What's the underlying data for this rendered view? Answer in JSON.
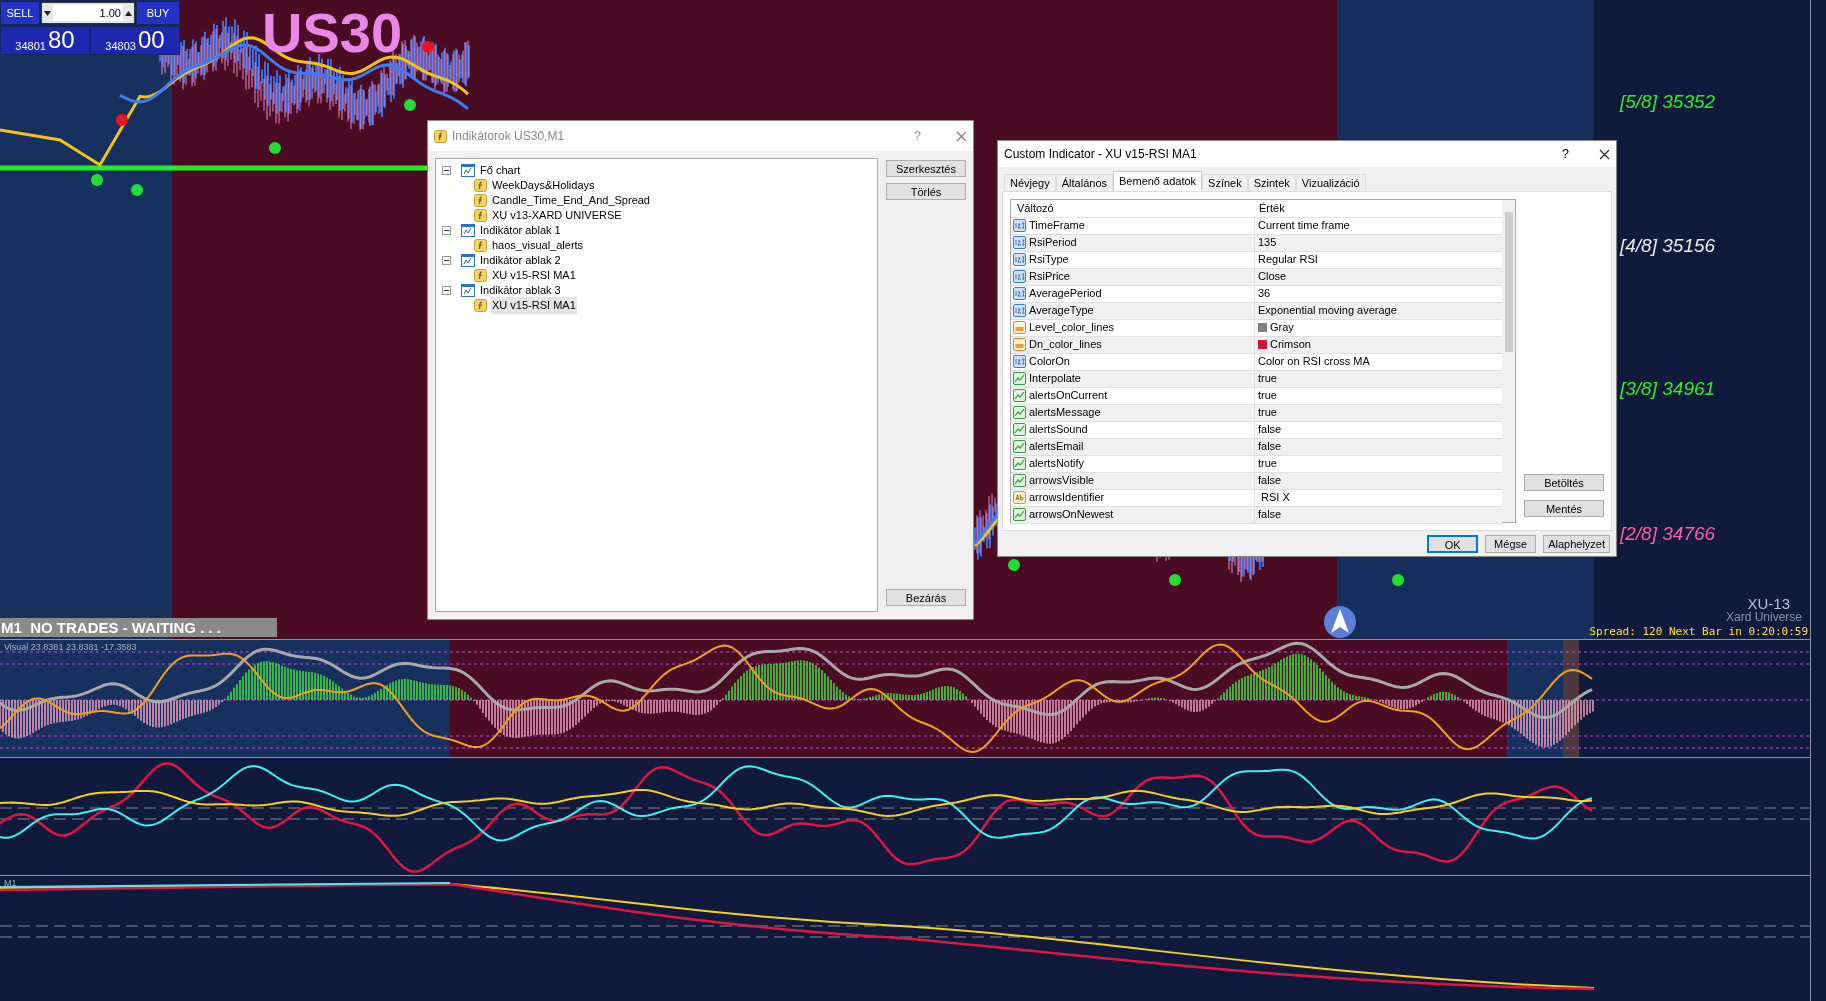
{
  "trade_panel": {
    "sell": "SELL",
    "lot": "1.00",
    "buy": "BUY",
    "bid_small": "34801",
    "bid_big": "80",
    "ask_small": "34803",
    "ask_big": "00"
  },
  "chart": {
    "symbol": "US30",
    "status": "M1  NO TRADES - WAITING . . .",
    "brand": "XU-13",
    "brand_sub": "Xard Universe",
    "spread": "Spread: 120 Next Bar in 0:20:0:59",
    "levels": [
      {
        "label": "[5/8] 35352",
        "color": "#33ee22"
      },
      {
        "label": "[4/8] 35156",
        "color": "#eeeeee"
      },
      {
        "label": "[3/8] 34961",
        "color": "#33ee22"
      },
      {
        "label": "[2/8] 34766",
        "color": "#ff5fa8"
      }
    ]
  },
  "indicator_labels": {
    "oscillator": "Visual 23.8381 23.8381 -17.3583",
    "trend": "M1"
  },
  "indicators_dialog": {
    "title": "Indikátorok US30,M1",
    "help": "?",
    "tree": [
      {
        "label": "Fő chart",
        "expanded": true,
        "children": [
          {
            "label": "WeekDays&Holidays",
            "selected": false
          },
          {
            "label": "Candle_Time_End_And_Spread",
            "selected": false
          },
          {
            "label": "XU v13-XARD UNIVERSE",
            "selected": false
          }
        ]
      },
      {
        "label": "Indikátor ablak 1",
        "expanded": true,
        "children": [
          {
            "label": "haos_visual_alerts",
            "selected": false
          }
        ]
      },
      {
        "label": "Indikátor ablak 2",
        "expanded": true,
        "children": [
          {
            "label": "XU v15-RSI MA1",
            "selected": false
          }
        ]
      },
      {
        "label": "Indikátor ablak 3",
        "expanded": true,
        "children": [
          {
            "label": "XU v15-RSI MA1",
            "selected": true
          }
        ]
      }
    ],
    "buttons": [
      "Szerkesztés",
      "Törlés"
    ],
    "close_button": "Bezárás"
  },
  "custom_dialog": {
    "title": "Custom Indicator - XU v15-RSI MA1",
    "help": "?",
    "tabs": [
      {
        "label": "Névjegy",
        "selected": false
      },
      {
        "label": "Általános",
        "selected": false
      },
      {
        "label": "Bemenő adatok",
        "selected": true
      },
      {
        "label": "Színek",
        "selected": false
      },
      {
        "label": "Szintek",
        "selected": false
      },
      {
        "label": "Vizualizáció",
        "selected": false
      }
    ],
    "columns": [
      "Változó",
      "Érték"
    ],
    "rows": [
      {
        "kind": "number",
        "name": "TimeFrame",
        "value": "Current time frame"
      },
      {
        "kind": "number",
        "name": "RsiPeriod",
        "value": "135"
      },
      {
        "kind": "number",
        "name": "RsiType",
        "value": "Regular RSI"
      },
      {
        "kind": "number",
        "name": "RsiPrice",
        "value": "Close"
      },
      {
        "kind": "number",
        "name": "AveragePeriod",
        "value": "36"
      },
      {
        "kind": "number",
        "name": "AverageType",
        "value": "Exponential moving average"
      },
      {
        "kind": "color",
        "name": "Level_color_lines",
        "value": "Gray",
        "color": "#808080"
      },
      {
        "kind": "color",
        "name": "Dn_color_lines",
        "value": "Crimson",
        "color": "#dc143c"
      },
      {
        "kind": "number",
        "name": "ColorOn",
        "value": "Color on RSI cross MA"
      },
      {
        "kind": "bool",
        "name": "Interpolate",
        "value": "true"
      },
      {
        "kind": "bool",
        "name": "alertsOnCurrent",
        "value": "true"
      },
      {
        "kind": "bool",
        "name": "alertsMessage",
        "value": "true"
      },
      {
        "kind": "bool",
        "name": "alertsSound",
        "value": "false"
      },
      {
        "kind": "bool",
        "name": "alertsEmail",
        "value": "false"
      },
      {
        "kind": "bool",
        "name": "alertsNotify",
        "value": "true"
      },
      {
        "kind": "bool",
        "name": "arrowsVisible",
        "value": "false"
      },
      {
        "kind": "string",
        "name": "arrowsIdentifier",
        "value": " RSI X"
      },
      {
        "kind": "bool",
        "name": "arrowsOnNewest",
        "value": "false"
      }
    ],
    "side_buttons": [
      "Betöltés",
      "Mentés"
    ],
    "buttons": [
      {
        "label": "OK",
        "default": true
      },
      {
        "label": "Mégse",
        "default": false
      },
      {
        "label": "Alaphelyzet",
        "default": false
      }
    ]
  }
}
